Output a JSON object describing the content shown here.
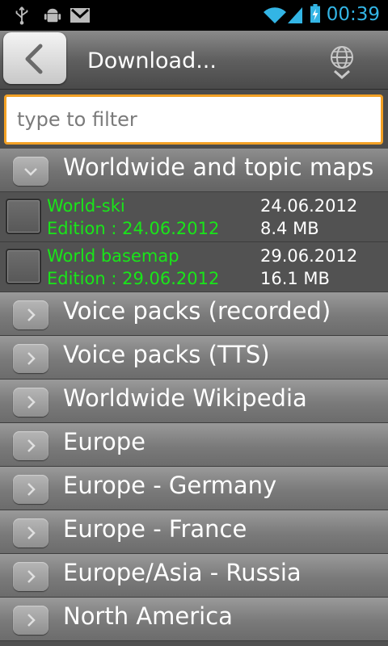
{
  "status_bar": {
    "time": "00:39",
    "left_icons": [
      "usb-icon",
      "android-debug-icon",
      "gmail-icon"
    ],
    "right_icons": [
      "wifi-icon",
      "signal-icon",
      "battery-charging-icon"
    ],
    "accent": "#33b5e5"
  },
  "header": {
    "title": "Download...",
    "back_icon": "chevron-left-icon",
    "globe_icon": "globe-download-icon"
  },
  "filter": {
    "placeholder": "type to filter",
    "border_color": "#f3a125"
  },
  "groups": [
    {
      "label": "Worldwide and topic maps",
      "expanded": true,
      "items": [
        {
          "name": "World-ski",
          "edition": "Edition : 24.06.2012",
          "date": "24.06.2012",
          "size": "8.4 MB"
        },
        {
          "name": "World basemap",
          "edition": "Edition : 29.06.2012",
          "date": "29.06.2012",
          "size": "16.1 MB"
        }
      ]
    },
    {
      "label": "Voice packs (recorded)",
      "expanded": false
    },
    {
      "label": "Voice packs (TTS)",
      "expanded": false
    },
    {
      "label": "Worldwide Wikipedia",
      "expanded": false
    },
    {
      "label": "Europe",
      "expanded": false
    },
    {
      "label": "Europe - Germany",
      "expanded": false
    },
    {
      "label": "Europe - France",
      "expanded": false
    },
    {
      "label": "Europe/Asia - Russia",
      "expanded": false
    },
    {
      "label": "North America",
      "expanded": false
    }
  ],
  "colors": {
    "item_text": "#19e619"
  }
}
